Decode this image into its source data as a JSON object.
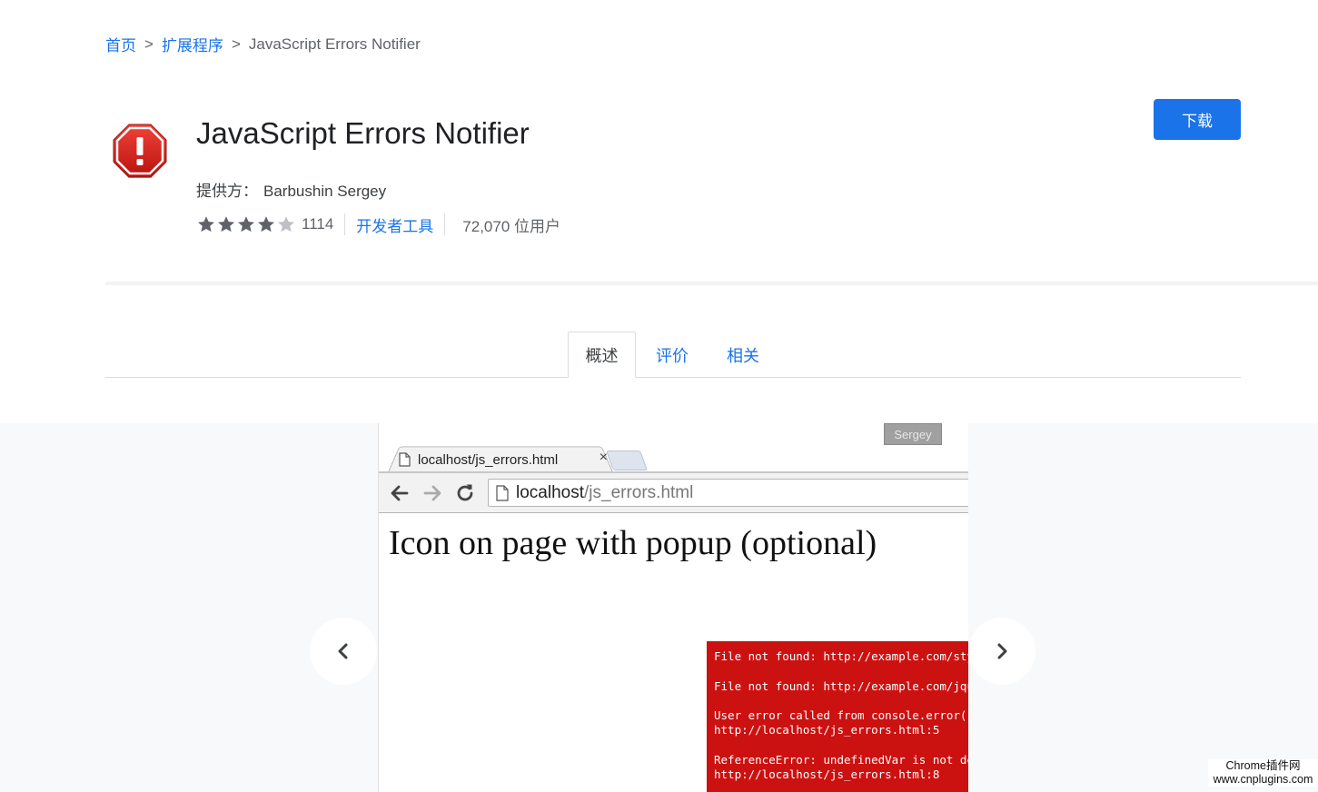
{
  "breadcrumb": {
    "items": [
      {
        "label": "首页"
      },
      {
        "label": "扩展程序"
      }
    ],
    "separator": ">",
    "current": "JavaScript Errors Notifier"
  },
  "extension": {
    "icon": "red-octagon-exclamation-icon",
    "title": "JavaScript Errors Notifier",
    "provider_label": "提供方：",
    "provider_name": "Barbushin Sergey",
    "rating": 4,
    "rating_max": 5,
    "rating_count": "1114",
    "category": "开发者工具",
    "users": "72,070 位用户"
  },
  "actions": {
    "download_label": "下载"
  },
  "tabs": [
    {
      "label": "概述",
      "active": true
    },
    {
      "label": "评价",
      "active": false
    },
    {
      "label": "相关",
      "active": false
    }
  ],
  "gallery": {
    "prev_icon": "chevron-left-icon",
    "next_icon": "chevron-right-icon",
    "screenshot": {
      "user_chip": "Sergey",
      "tab_title": "localhost/js_errors.html",
      "tab_close": "×",
      "url_host": "localhost",
      "url_path": "/js_errors.html",
      "heading": "Icon on page with popup (optional)",
      "errors": [
        "File not found: http://example.com/style.css",
        "",
        "File not found: http://example.com/jquery.js",
        "",
        "User error called from console.error()",
        "http://localhost/js_errors.html:5",
        "",
        "ReferenceError: undefinedVar is not defined",
        "http://localhost/js_errors.html:8"
      ]
    }
  },
  "watermark": {
    "line1": "Chrome插件网",
    "line2": "www.cnplugins.com"
  },
  "colors": {
    "accent": "#1a73e8",
    "error_red": "#cc1111",
    "star": "#5f6368",
    "star_empty": "#bdc1c6"
  }
}
